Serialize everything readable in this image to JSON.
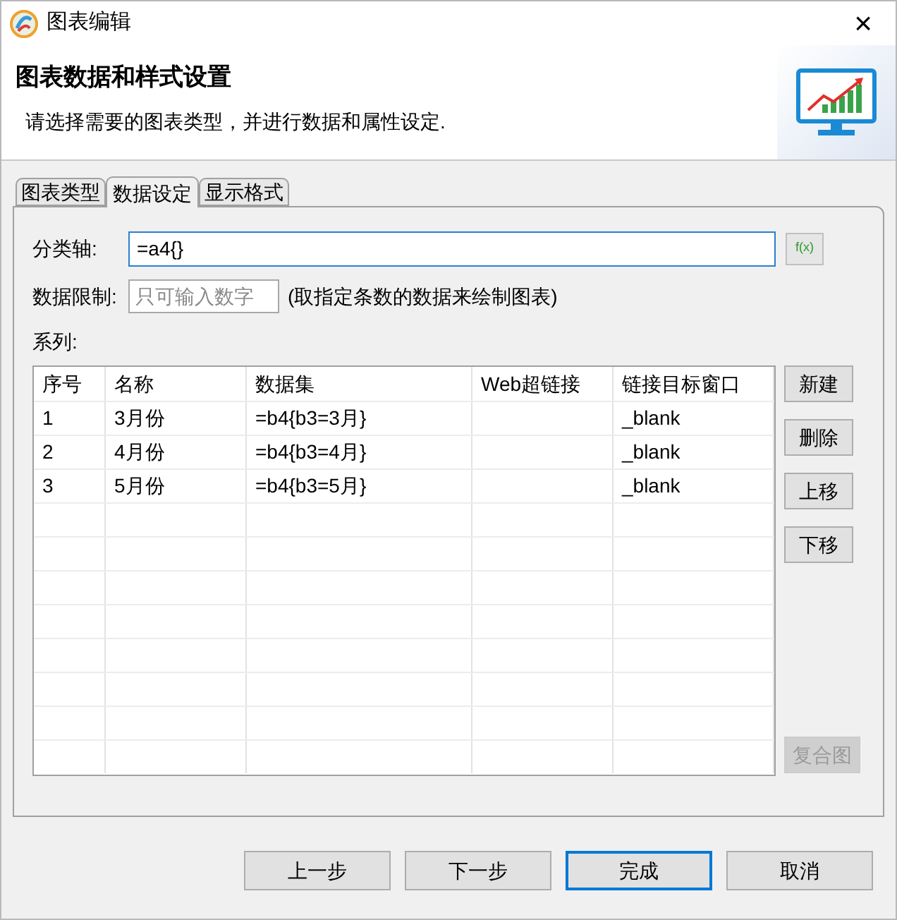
{
  "window": {
    "title": "图表编辑",
    "close": "×"
  },
  "header": {
    "title": "图表数据和样式设置",
    "subtitle": "请选择需要的图表类型，并进行数据和属性设定."
  },
  "tabs": [
    {
      "label": "图表类型",
      "selected": false
    },
    {
      "label": "数据设定",
      "selected": true
    },
    {
      "label": "显示格式",
      "selected": false
    }
  ],
  "category_axis": {
    "label": "分类轴:",
    "value": "=a4{}",
    "formula_button": "f(x)"
  },
  "data_limit": {
    "label": "数据限制:",
    "placeholder": "只可输入数字",
    "hint": "(取指定条数的数据来绘制图表)"
  },
  "series": {
    "label": "系列:",
    "columns": [
      "序号",
      "名称",
      "数据集",
      "Web超链接",
      "链接目标窗口"
    ],
    "rows": [
      [
        "1",
        "3月份",
        "=b4{b3=3月}",
        "",
        "_blank"
      ],
      [
        "2",
        "4月份",
        "=b4{b3=4月}",
        "",
        "_blank"
      ],
      [
        "3",
        "5月份",
        "=b4{b3=5月}",
        "",
        "_blank"
      ]
    ],
    "buttons": [
      {
        "label": "新建",
        "disabled": false
      },
      {
        "label": "删除",
        "disabled": false
      },
      {
        "label": "上移",
        "disabled": false
      },
      {
        "label": "下移",
        "disabled": false
      }
    ],
    "combo_button": {
      "label": "复合图",
      "disabled": true
    }
  },
  "footer_buttons": [
    {
      "label": "上一步",
      "default": false
    },
    {
      "label": "下一步",
      "default": false
    },
    {
      "label": "完成",
      "default": true
    },
    {
      "label": "取消",
      "default": false
    }
  ]
}
